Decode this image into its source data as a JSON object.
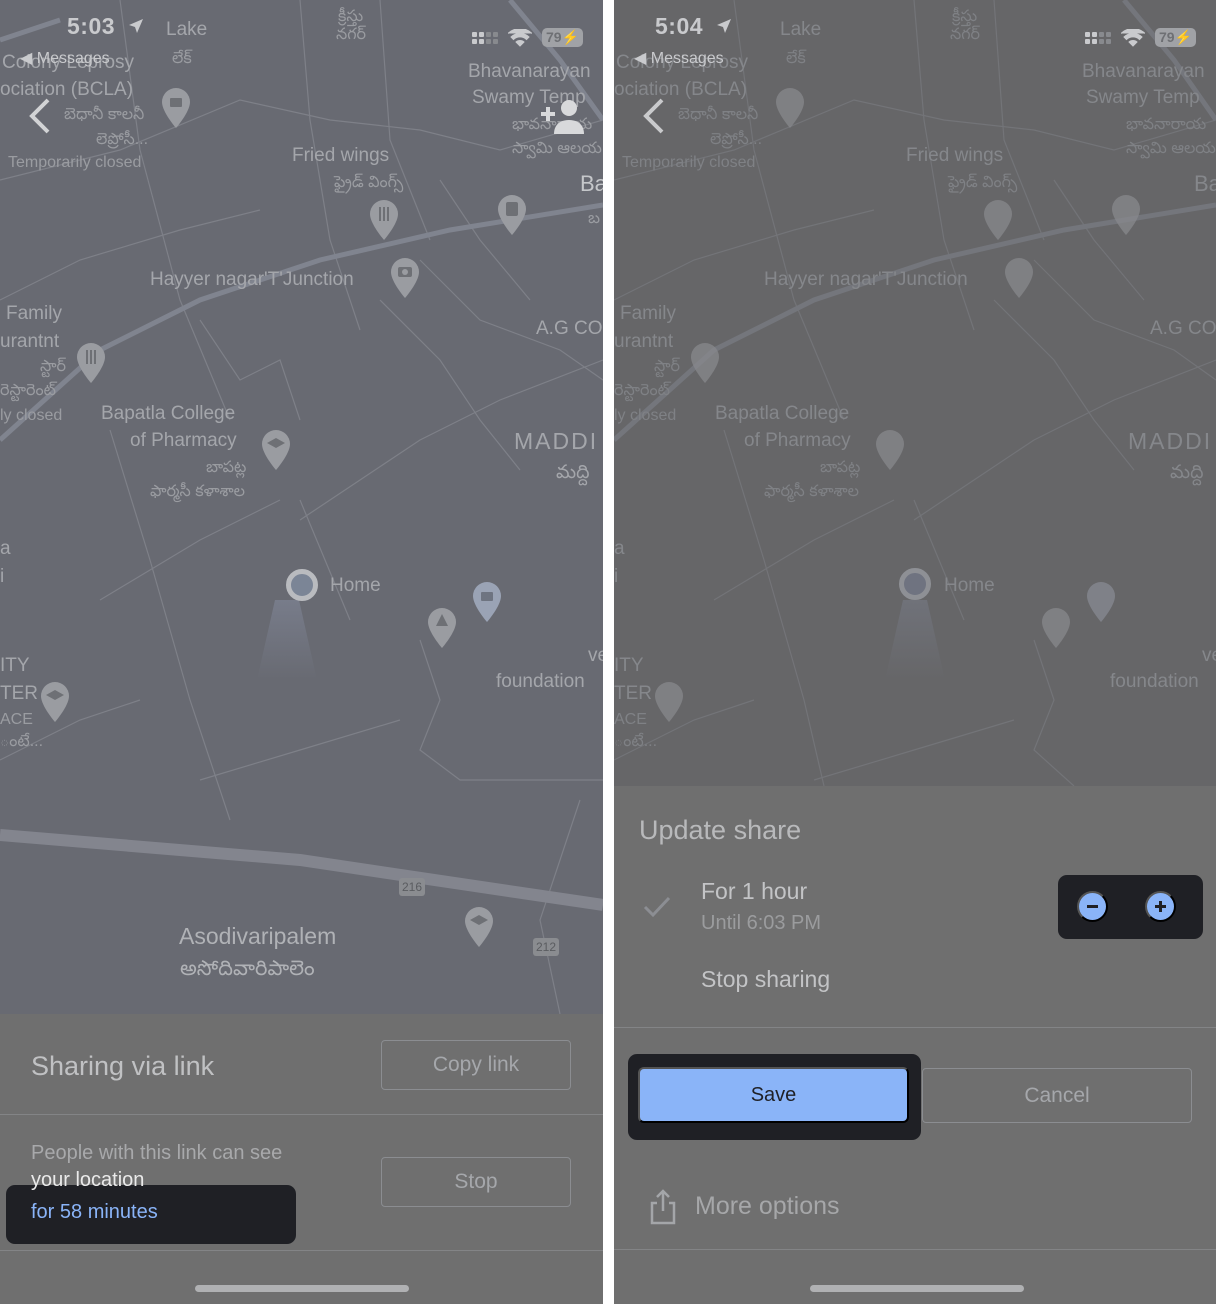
{
  "colors": {
    "accent": "#8ab4f8",
    "highlight_bg": "#1f2025",
    "divider": "#ffffff"
  },
  "left": {
    "status": {
      "time": "5:03",
      "back_app": "Messages",
      "battery": "79"
    },
    "map_labels": {
      "colony_1": "Colony Leprosy",
      "colony_2": "ociation (BCLA)",
      "colony_te_1": "బెధానీ కాలనీ",
      "colony_te_2": "లెప్రోసీ...",
      "temp_closed": "Temporarily closed",
      "lake": "Lake",
      "lake_te": "లేక్",
      "kristu_1": "క్రీస్తు",
      "kristu_2": "నగర్",
      "bhavan_1": "Bhavanarayan",
      "bhavan_2": "Swamy Temp",
      "bhavan_te_1": "భావనారాయ",
      "bhavan_te_2": "స్వామి ఆలయ",
      "fried_wings": "Fried wings",
      "fried_wings_te": "ఫ్రైడ్ వింగ్స్",
      "ba": "Ba",
      "ba_te": "బ",
      "hayyer": "Hayyer nagar'T'Junction",
      "family_1": "Family",
      "family_2": "urantnt",
      "family_te_1": "స్టార్",
      "family_te_2": "రెస్టారెంట్",
      "family_closed": "ly closed",
      "agco": "A.G CO",
      "bapatla_1": "Bapatla College",
      "bapatla_2": "of Pharmacy",
      "bapatla_te_1": "బాపట్ల",
      "bapatla_te_2": "ఫార్మసీ కళాశాల",
      "maddi": "MADDI",
      "maddi_te": "మద్ది",
      "a": "a",
      "i": "i",
      "home": "Home",
      "ve": "ve",
      "foundation": "foundation",
      "city_1": "ITY",
      "city_2": "TER",
      "city_3": "ACE",
      "city_te": "ంటే...",
      "route_216": "216",
      "route_212": "212",
      "asodivaripalem": "Asodivaripalem",
      "asodivaripalem_te": "అసోదివారిపాలెం"
    },
    "sheet": {
      "title": "Sharing via link",
      "copy_link": "Copy link",
      "description_1": "People with this link can see",
      "description_2": "your location",
      "duration": "for 58 minutes",
      "stop": "Stop"
    }
  },
  "right": {
    "status": {
      "time": "5:04",
      "back_app": "Messages",
      "battery": "79"
    },
    "sheet": {
      "title": "Update share",
      "option_selected": "For 1 hour",
      "option_until": "Until 6:03 PM",
      "option_stop": "Stop sharing",
      "save": "Save",
      "cancel": "Cancel",
      "more_options": "More options"
    }
  }
}
